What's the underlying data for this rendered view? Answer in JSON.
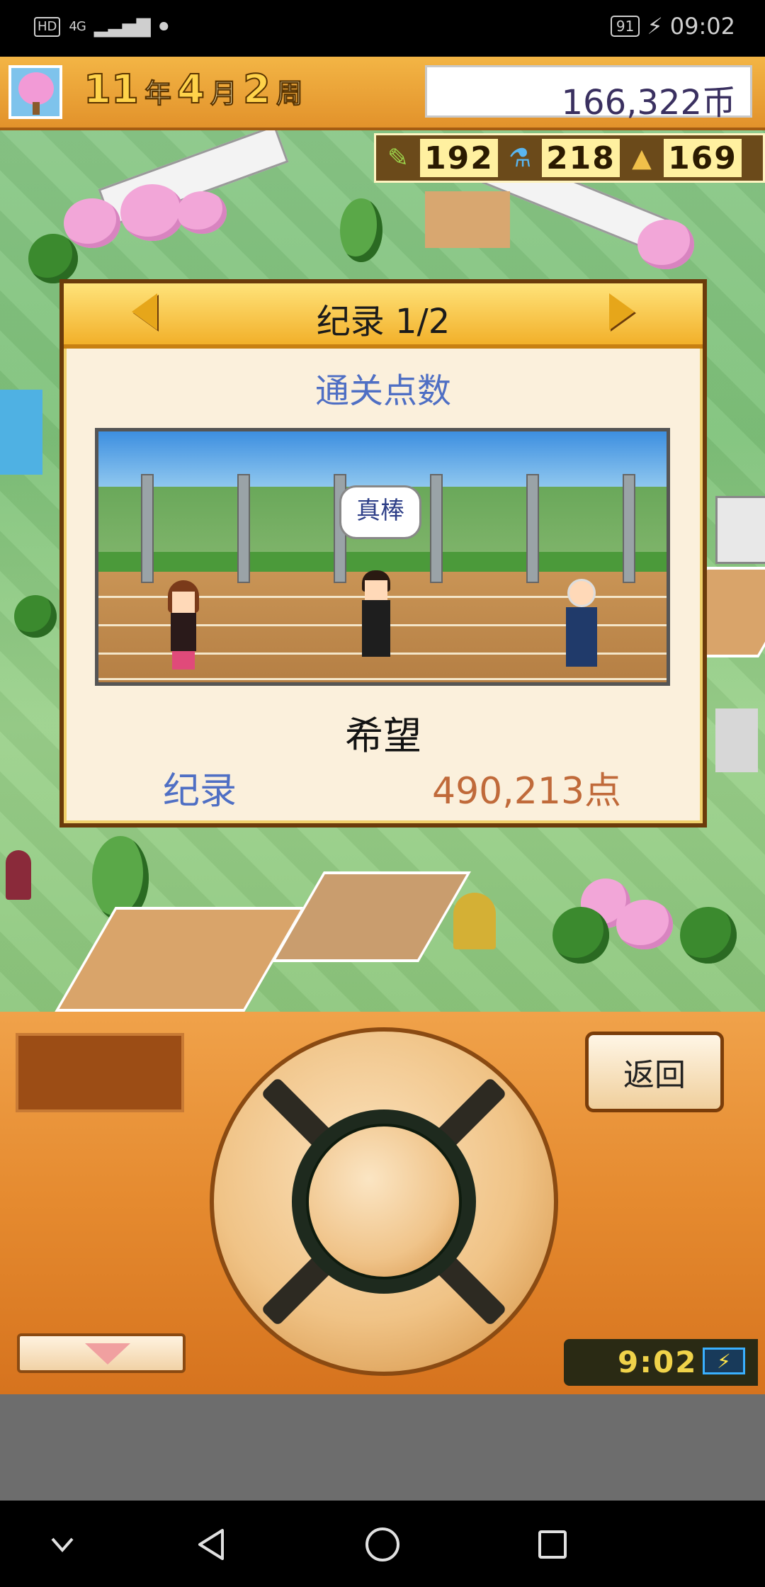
{
  "status_bar": {
    "hd_label": "HD",
    "network_label": "4G",
    "battery_level": "91",
    "time": "09:02"
  },
  "hud": {
    "date": {
      "year": "11",
      "year_unit": "年",
      "month": "4",
      "month_unit": "月",
      "week": "2",
      "week_unit": "周"
    },
    "money": "166,322币",
    "stats": [
      {
        "icon": "pencil-icon",
        "value": "192"
      },
      {
        "icon": "flask-icon",
        "value": "218"
      },
      {
        "icon": "cone-icon",
        "value": "169"
      }
    ]
  },
  "dialog": {
    "title": "纪录 1/2",
    "subtitle": "通关点数",
    "speech_bubble": "真棒",
    "name": "希望",
    "record_label": "纪录",
    "record_value": "490,213点"
  },
  "controller": {
    "back_label": "返回",
    "clock": "9:02"
  },
  "colors": {
    "hud_orange": "#e2922b",
    "dialog_header": "#f2b02a",
    "subtitle_blue": "#4f6fc4",
    "record_value": "#c06a3a",
    "controller_orange": "#e58a2f"
  }
}
